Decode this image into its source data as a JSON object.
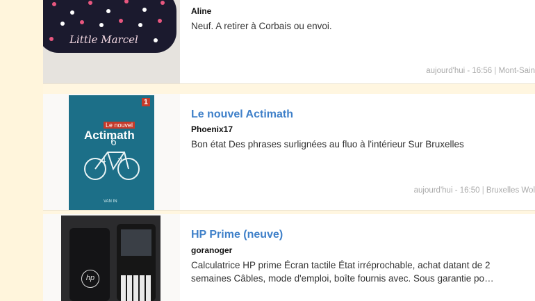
{
  "listings": [
    {
      "title": "",
      "seller": "Aline",
      "description": "Neuf. A retirer à Corbais ou envoi.",
      "time": "aujourd'hui - 16:56",
      "separator": "|",
      "location": "Mont-Sain",
      "image_text": "Little Marcel"
    },
    {
      "title": "Le nouvel Actimath",
      "seller": "Phoenix17",
      "description": "Bon état Des phrases surlignées au fluo à l'intérieur Sur Bruxelles",
      "time": "aujourd'hui - 16:50",
      "separator": "|",
      "location": "Bruxelles Wol",
      "cover_badge": "Le nouvel",
      "cover_title": "Actimath",
      "cover_grade": "1",
      "cover_publisher": "VAN IN"
    },
    {
      "title": "HP Prime (neuve)",
      "seller": "goranoger",
      "description": "Calculatrice HP prime Écran tactile État irréprochable, achat datant de 2 semaines Câbles, mode d'emploi, boîte fournis avec. Sous garantie po…",
      "image_logo": "hp"
    }
  ],
  "colors": {
    "page_background": "#fff5dc",
    "title_link": "#3f80c9",
    "meta_text": "#aaaaaa"
  },
  "icons": {
    "case_pattern": "polka-dot-pencil-case",
    "book_illustration": "bicycle-numbers",
    "calculator": "graphing-calculator"
  }
}
